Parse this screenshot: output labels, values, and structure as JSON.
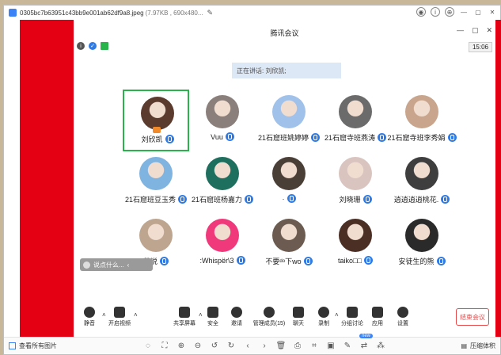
{
  "viewer": {
    "filename": "0305bc7b63951c43bb9e001ab62df9a8.jpeg",
    "fileinfo": "(7.97KB , 690x480...",
    "view_all_label": "查看所有图片",
    "compress_label": "压缩体积",
    "new_badge": "new"
  },
  "meeting": {
    "title": "腾讯会议",
    "time": "15:06",
    "speaking": "正在讲话: 刘欣凯;",
    "chat_preview": "说点什么...",
    "end_label": "结束会议",
    "participants": [
      {
        "name": "刘欣凯",
        "color": "#5a3b2e"
      },
      {
        "name": "Vuu",
        "color": "#8a7f7a"
      },
      {
        "name": "21石窟班姚婷婷",
        "color": "#9fc1ea"
      },
      {
        "name": "21石窟寺班燕涛",
        "color": "#6b6b6b"
      },
      {
        "name": "21石窟寺班李秀娟",
        "color": "#c8a58c"
      },
      {
        "name": "21石窟班豆玉秀",
        "color": "#7fb3e0"
      },
      {
        "name": "21石窟班杨嘉力",
        "color": "#1f6f5e"
      },
      {
        "name": "·",
        "color": "#4a3f36"
      },
      {
        "name": "刘晓珊",
        "color": "#d9c4c0"
      },
      {
        "name": "逍逍逍逍桃花.",
        "color": "#3e3e3e"
      },
      {
        "name": "莫说",
        "color": "#bda58f"
      },
      {
        "name": ":Whispër\\3",
        "color": "#f0397a"
      },
      {
        "name": "不要ᵈᵒ下wo",
        "color": "#6b5b50"
      },
      {
        "name": "taiko□□",
        "color": "#4b2f25"
      },
      {
        "name": "安徒生的熊",
        "color": "#2a2a2a"
      }
    ],
    "toolbar": {
      "mute": "静音",
      "video": "开启视频",
      "share": "共享屏幕",
      "security": "安全",
      "invite": "邀请",
      "members": "管理成员(15)",
      "chat": "聊天",
      "record": "录制",
      "breakout": "分组讨论",
      "apps": "应用",
      "settings": "设置"
    }
  }
}
